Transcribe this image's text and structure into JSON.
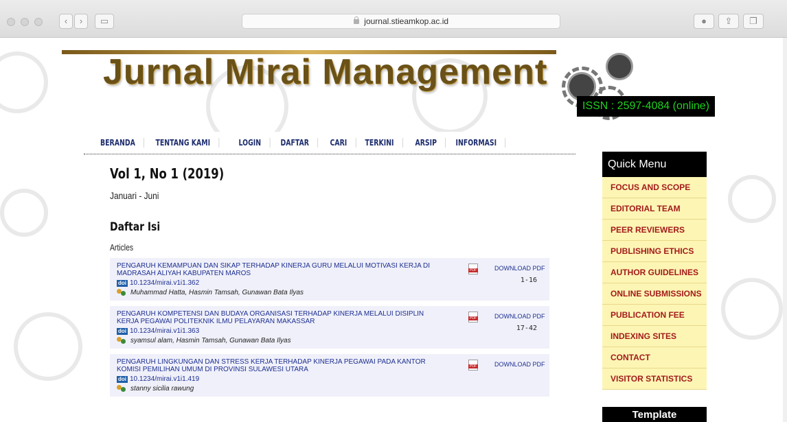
{
  "browser": {
    "url": "journal.stieamkop.ac.id"
  },
  "banner": {
    "title": "Jurnal Mirai Management",
    "issn": "ISSN : 2597-4084 (online)"
  },
  "nav": {
    "items": [
      "BERANDA",
      "TENTANG KAMI",
      "LOGIN",
      "DAFTAR",
      "CARI",
      "TERKINI",
      "ARSIP",
      "INFORMASI"
    ]
  },
  "issue": {
    "title": "Vol 1, No 1 (2019)",
    "subtitle": "Januari - Juni",
    "toc_title": "Daftar Isi",
    "section": "Articles"
  },
  "articles": [
    {
      "title": "PENGARUH KEMAMPUAN DAN SIKAP TERHADAP KINERJA GURU MELALUI MOTIVASI KERJA DI MADRASAH ALIYAH KABUPATEN MAROS",
      "doi": "10.1234/mirai.v1i1.362",
      "authors": "Muhammad Hatta, Hasmin Tamsah, Gunawan Bata Ilyas",
      "download": "DOWNLOAD PDF",
      "pages": "1-16"
    },
    {
      "title": "PENGARUH KOMPETENSI DAN BUDAYA ORGANISASI TERHADAP KINERJA MELALUI DISIPLIN KERJA PEGAWAI POLITEKNIK ILMU PELAYARAN MAKASSAR",
      "doi": "10.1234/mirai.v1i1.363",
      "authors": "syamsul alam, Hasmin Tamsah, Gunawan Bata Ilyas",
      "download": "DOWNLOAD PDF",
      "pages": "17-42"
    },
    {
      "title": "PENGARUH LINGKUNGAN DAN STRESS KERJA TERHADAP KINERJA PEGAWAI PADA KANTOR KOMISI PEMILIHAN UMUM DI PROVINSI SULAWESI UTARA",
      "doi": "10.1234/mirai.v1i1.419",
      "authors": "stanny sicilia rawung",
      "download": "DOWNLOAD PDF",
      "pages": ""
    }
  ],
  "doi_badge": "doi",
  "sidebar": {
    "header": "Quick Menu",
    "items": [
      "FOCUS AND SCOPE",
      "EDITORIAL TEAM",
      "PEER REVIEWERS",
      "PUBLISHING ETHICS",
      "AUTHOR GUIDELINES",
      "ONLINE SUBMISSIONS",
      "PUBLICATION FEE",
      "INDEXING SITES",
      "CONTACT",
      "VISITOR STATISTICS"
    ],
    "template_header": "Template"
  },
  "colors": {
    "nav_text": "#1d2d6e",
    "article_link": "#1b2f8f",
    "menu_item_bg": "#fdf5b4",
    "menu_item_text": "#a31b1b",
    "issn_text": "#20d020"
  }
}
